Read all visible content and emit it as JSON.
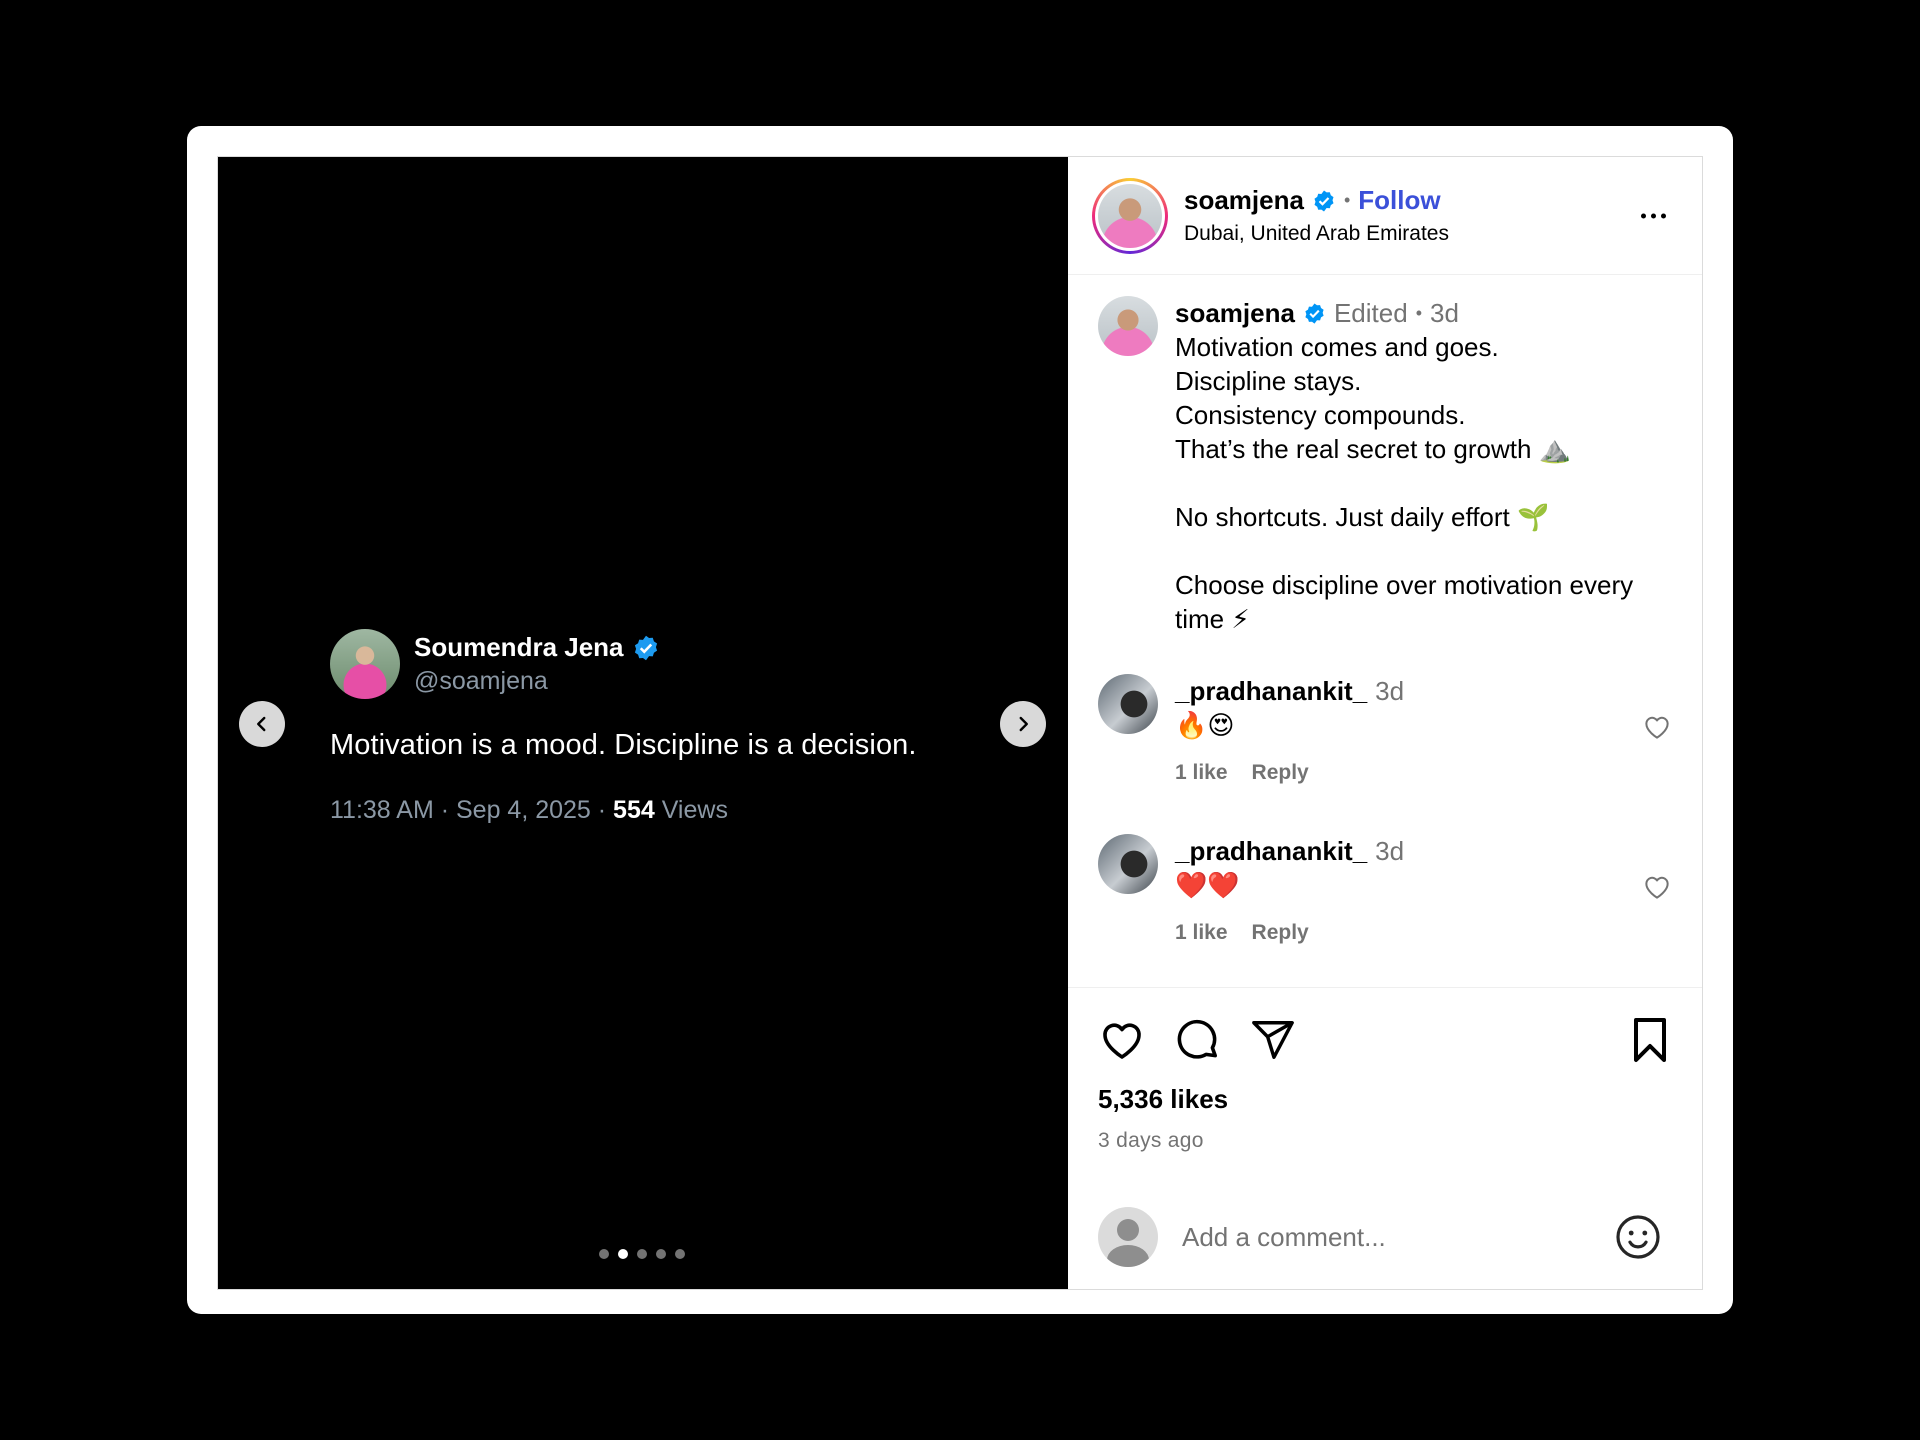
{
  "media": {
    "tweet": {
      "name": "Soumendra Jena",
      "handle": "@soamjena",
      "text": "Motivation is a mood. Discipline is a decision.",
      "time": "11:38 AM · Sep 4, 2025 · ",
      "views_count": "554",
      "views_label": " Views"
    },
    "carousel": {
      "total": 5,
      "active_index": 1
    }
  },
  "header": {
    "username": "soamjena",
    "separator": "•",
    "follow_label": "Follow",
    "location": "Dubai, United Arab Emirates"
  },
  "caption": {
    "username": "soamjena",
    "edited": "Edited",
    "dot": "•",
    "time": "3d",
    "lines": [
      "Motivation comes and goes.",
      "Discipline stays.",
      "Consistency compounds.",
      "That’s the real secret to growth ⛰️",
      "",
      "No shortcuts. Just daily effort 🌱",
      "",
      "Choose discipline over motivation every time ⚡"
    ]
  },
  "comments": [
    {
      "username": "_pradhanankit_",
      "time": "3d",
      "text": "🔥😍",
      "likes": "1 like",
      "reply": "Reply"
    },
    {
      "username": "_pradhanankit_",
      "time": "3d",
      "text": "❤️❤️",
      "likes": "1 like",
      "reply": "Reply"
    }
  ],
  "stats": {
    "likes": "5,336 likes",
    "ago": "3 days ago"
  },
  "composer": {
    "placeholder": "Add a comment..."
  },
  "icons": {
    "verified": "verified-badge-icon",
    "like": "heart-icon",
    "comment": "comment-icon",
    "share": "share-icon",
    "save": "bookmark-icon",
    "emoji": "emoji-icon"
  },
  "colors": {
    "verified": "#0095f6",
    "follow": "#3b50d9",
    "muted": "#737373"
  }
}
